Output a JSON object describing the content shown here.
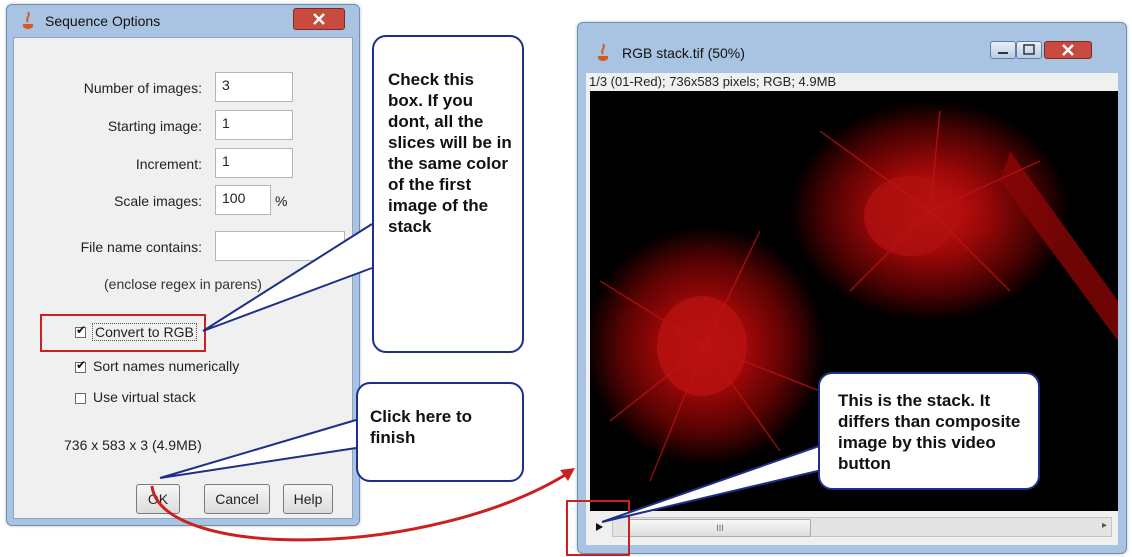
{
  "sequence_dialog": {
    "title": "Sequence Options",
    "fields": {
      "num_images_label": "Number of images:",
      "num_images_value": "3",
      "starting_image_label": "Starting image:",
      "starting_image_value": "1",
      "increment_label": "Increment:",
      "increment_value": "1",
      "scale_label": "Scale images:",
      "scale_value": "100",
      "scale_unit": "%",
      "file_name_label": "File name contains:",
      "file_name_value": "",
      "regex_note": "(enclose regex in parens)"
    },
    "checkboxes": {
      "convert_rgb": "Convert to RGB",
      "sort_numeric": "Sort names numerically",
      "virtual_stack": "Use virtual stack"
    },
    "size_info": "736 x 583 x 3 (4.9MB)",
    "buttons": {
      "ok": "OK",
      "cancel": "Cancel",
      "help": "Help"
    }
  },
  "image_window": {
    "title": "RGB stack.tif (50%)",
    "info": "1/3 (01-Red); 736x583 pixels; RGB; 4.9MB",
    "scroll_thumb": "III"
  },
  "callouts": {
    "checkbox_note": "Check this box. If you dont, all the slices will be in the same color of the first image of the stack",
    "finish_note": "Click here to finish",
    "stack_note": "This is the stack. It differs than composite image by this video button"
  },
  "colors": {
    "titlebar": "#a9c4e3",
    "callout_border": "#1d2f87",
    "highlight": "#cc2020",
    "close_button": "#c94a3e"
  }
}
